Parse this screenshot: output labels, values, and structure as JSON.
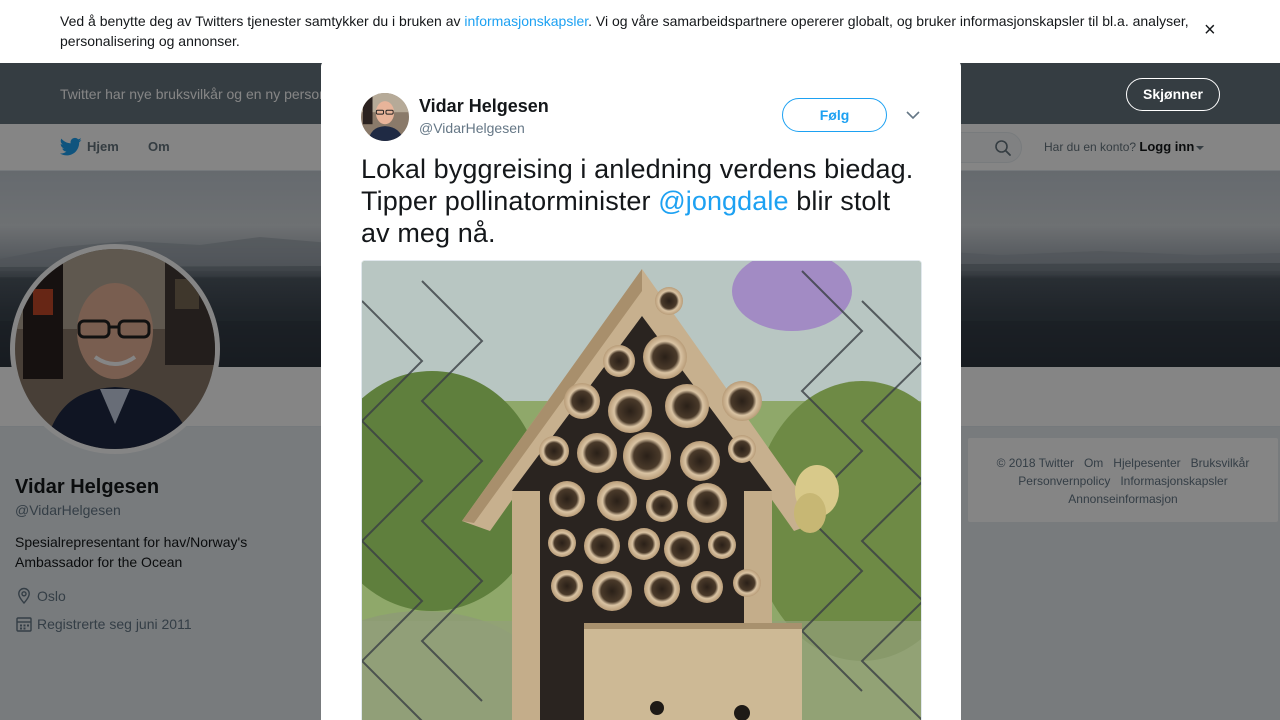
{
  "cookie": {
    "text_before": "Ved å benytte deg av Twitters tjenester samtykker du i bruken av ",
    "link": "informasjonskapsler",
    "text_after": ". Vi og våre samarbeidspartnere opererer globalt, og bruker informasjonskapsler til bl.a. analyser, personalisering og annonser.",
    "close": "×"
  },
  "tos": {
    "text": "Twitter har nye bruksvilkår og en ny personvernpolicy",
    "button": "Skjønner"
  },
  "nav": {
    "home": "Hjem",
    "about": "Om",
    "login_prompt": "Har du en konto?",
    "login_link": "Logg inn"
  },
  "profile": {
    "name": "Vidar Helgesen",
    "handle": "@VidarHelgesen",
    "bio": "Spesialrepresentant for hav/Norway's Ambassador for the Ocean",
    "location": "Oslo",
    "joined": "Registrerte seg juni 2011"
  },
  "footer": {
    "links": [
      "© 2018 Twitter",
      "Om",
      "Hjelpesenter",
      "Bruksvilkår",
      "Personvernpolicy",
      "Informasjonskapsler",
      "Annonseinformasjon"
    ]
  },
  "tweet": {
    "name": "Vidar Helgesen",
    "handle": "@VidarHelgesen",
    "follow": "Følg",
    "text_before": "Lokal byggreising i anledning verdens biedag. Tipper pollinatorminister ",
    "mention": "@jongdale",
    "text_after": " blir stolt av meg nå."
  },
  "colors": {
    "accent": "#1da1f2",
    "tos_bar": "#66757f",
    "background": "#e6ecf0"
  }
}
